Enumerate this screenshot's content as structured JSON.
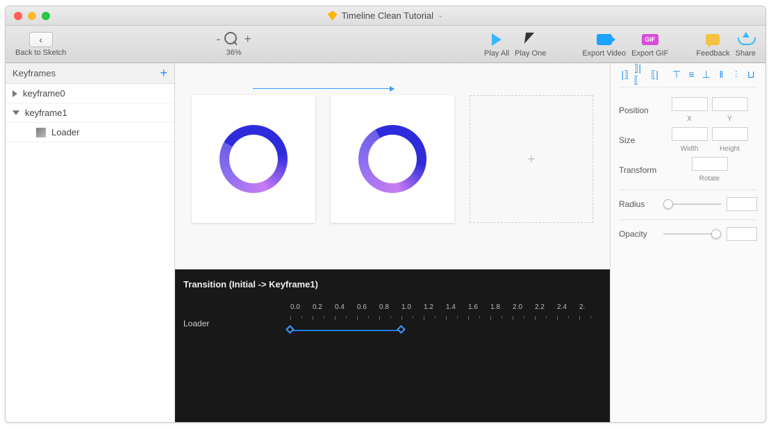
{
  "window": {
    "title": "Timeline Clean Tutorial"
  },
  "toolbar": {
    "back_label": "Back to Sketch",
    "zoom_pct": "36%",
    "play_all": "Play All",
    "play_one": "Play One",
    "export_video": "Export Video",
    "export_gif": "Export GIF",
    "gif_badge": "GIF",
    "feedback": "Feedback",
    "share": "Share"
  },
  "sidebar": {
    "header": "Keyframes",
    "items": [
      {
        "label": "keyframe0",
        "expanded": false
      },
      {
        "label": "keyframe1",
        "expanded": true
      }
    ],
    "child_label": "Loader"
  },
  "timeline": {
    "title": "Transition (Initial -> Keyframe1)",
    "track_name": "Loader",
    "ticks": [
      "0.0",
      "0.2",
      "0.4",
      "0.6",
      "0.8",
      "1.0",
      "1.2",
      "1.4",
      "1.6",
      "1.8",
      "2.0",
      "2.2",
      "2.4",
      "2."
    ]
  },
  "inspector": {
    "position": {
      "label": "Position",
      "x_label": "X",
      "y_label": "Y"
    },
    "size": {
      "label": "Size",
      "w_label": "Width",
      "h_label": "Height"
    },
    "transform": {
      "label": "Transform",
      "r_label": "Rotate"
    },
    "radius_label": "Radius",
    "opacity_label": "Opacity"
  }
}
